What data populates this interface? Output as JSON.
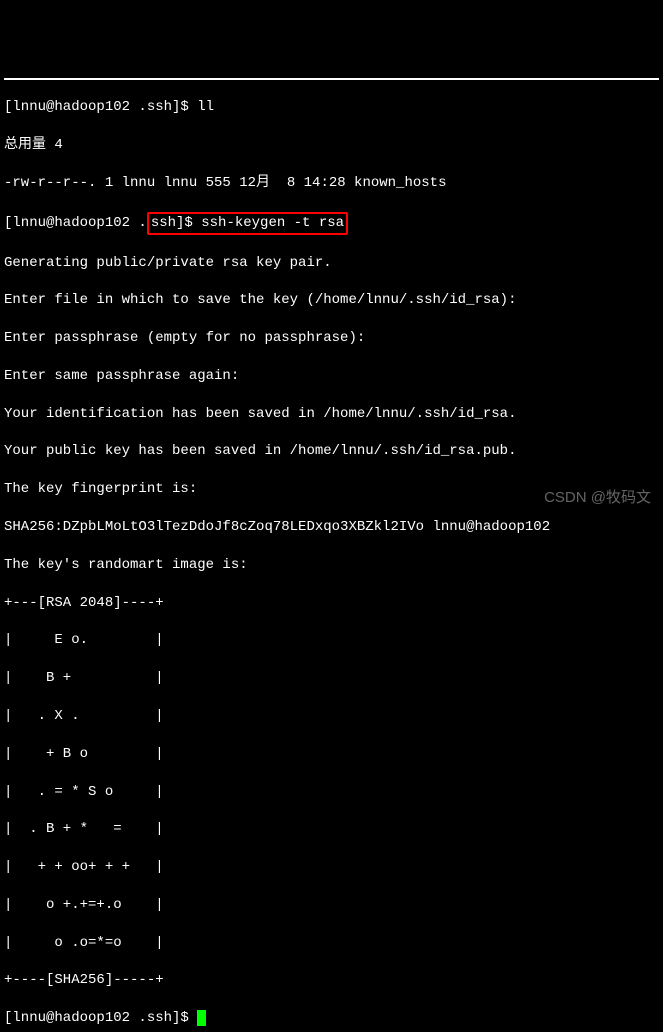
{
  "prompt1": "[lnnu@hadoop102 .ssh]$ ",
  "cmd1": "ll",
  "total_line": "总用量 4",
  "file_listing": "-rw-r--r--. 1 lnnu lnnu 555 12月  8 14:28 known_hosts",
  "prompt2_pre": "[lnnu@hadoop102 .",
  "prompt2_highlight": "ssh]$ ssh-keygen -t rsa",
  "out": {
    "l1": "Generating public/private rsa key pair.",
    "l2": "Enter file in which to save the key (/home/lnnu/.ssh/id_rsa):",
    "l3": "Enter passphrase (empty for no passphrase):",
    "l4": "Enter same passphrase again:",
    "l5": "Your identification has been saved in /home/lnnu/.ssh/id_rsa.",
    "l6": "Your public key has been saved in /home/lnnu/.ssh/id_rsa.pub.",
    "l7": "The key fingerprint is:",
    "l8": "SHA256:DZpbLMoLtO3lTezDdoJf8cZoq78LEDxqo3XBZkl2IVo lnnu@hadoop102",
    "l9": "The key's randomart image is:"
  },
  "art": {
    "a0": "+---[RSA 2048]----+",
    "a1": "|     E o.        |",
    "a2": "|    B +          |",
    "a3": "|   . X .         |",
    "a4": "|    + B o        |",
    "a5": "|   . = * S o     |",
    "a6": "|  . B + *   =    |",
    "a7": "|   + + oo+ + +   |",
    "a8": "|    o +.+=+.o    |",
    "a9": "|     o .o=*=o    |",
    "a10": "+----[SHA256]-----+"
  },
  "prompt3": "[lnnu@hadoop102 .ssh]$ ",
  "watermark": "CSDN @牧码文"
}
